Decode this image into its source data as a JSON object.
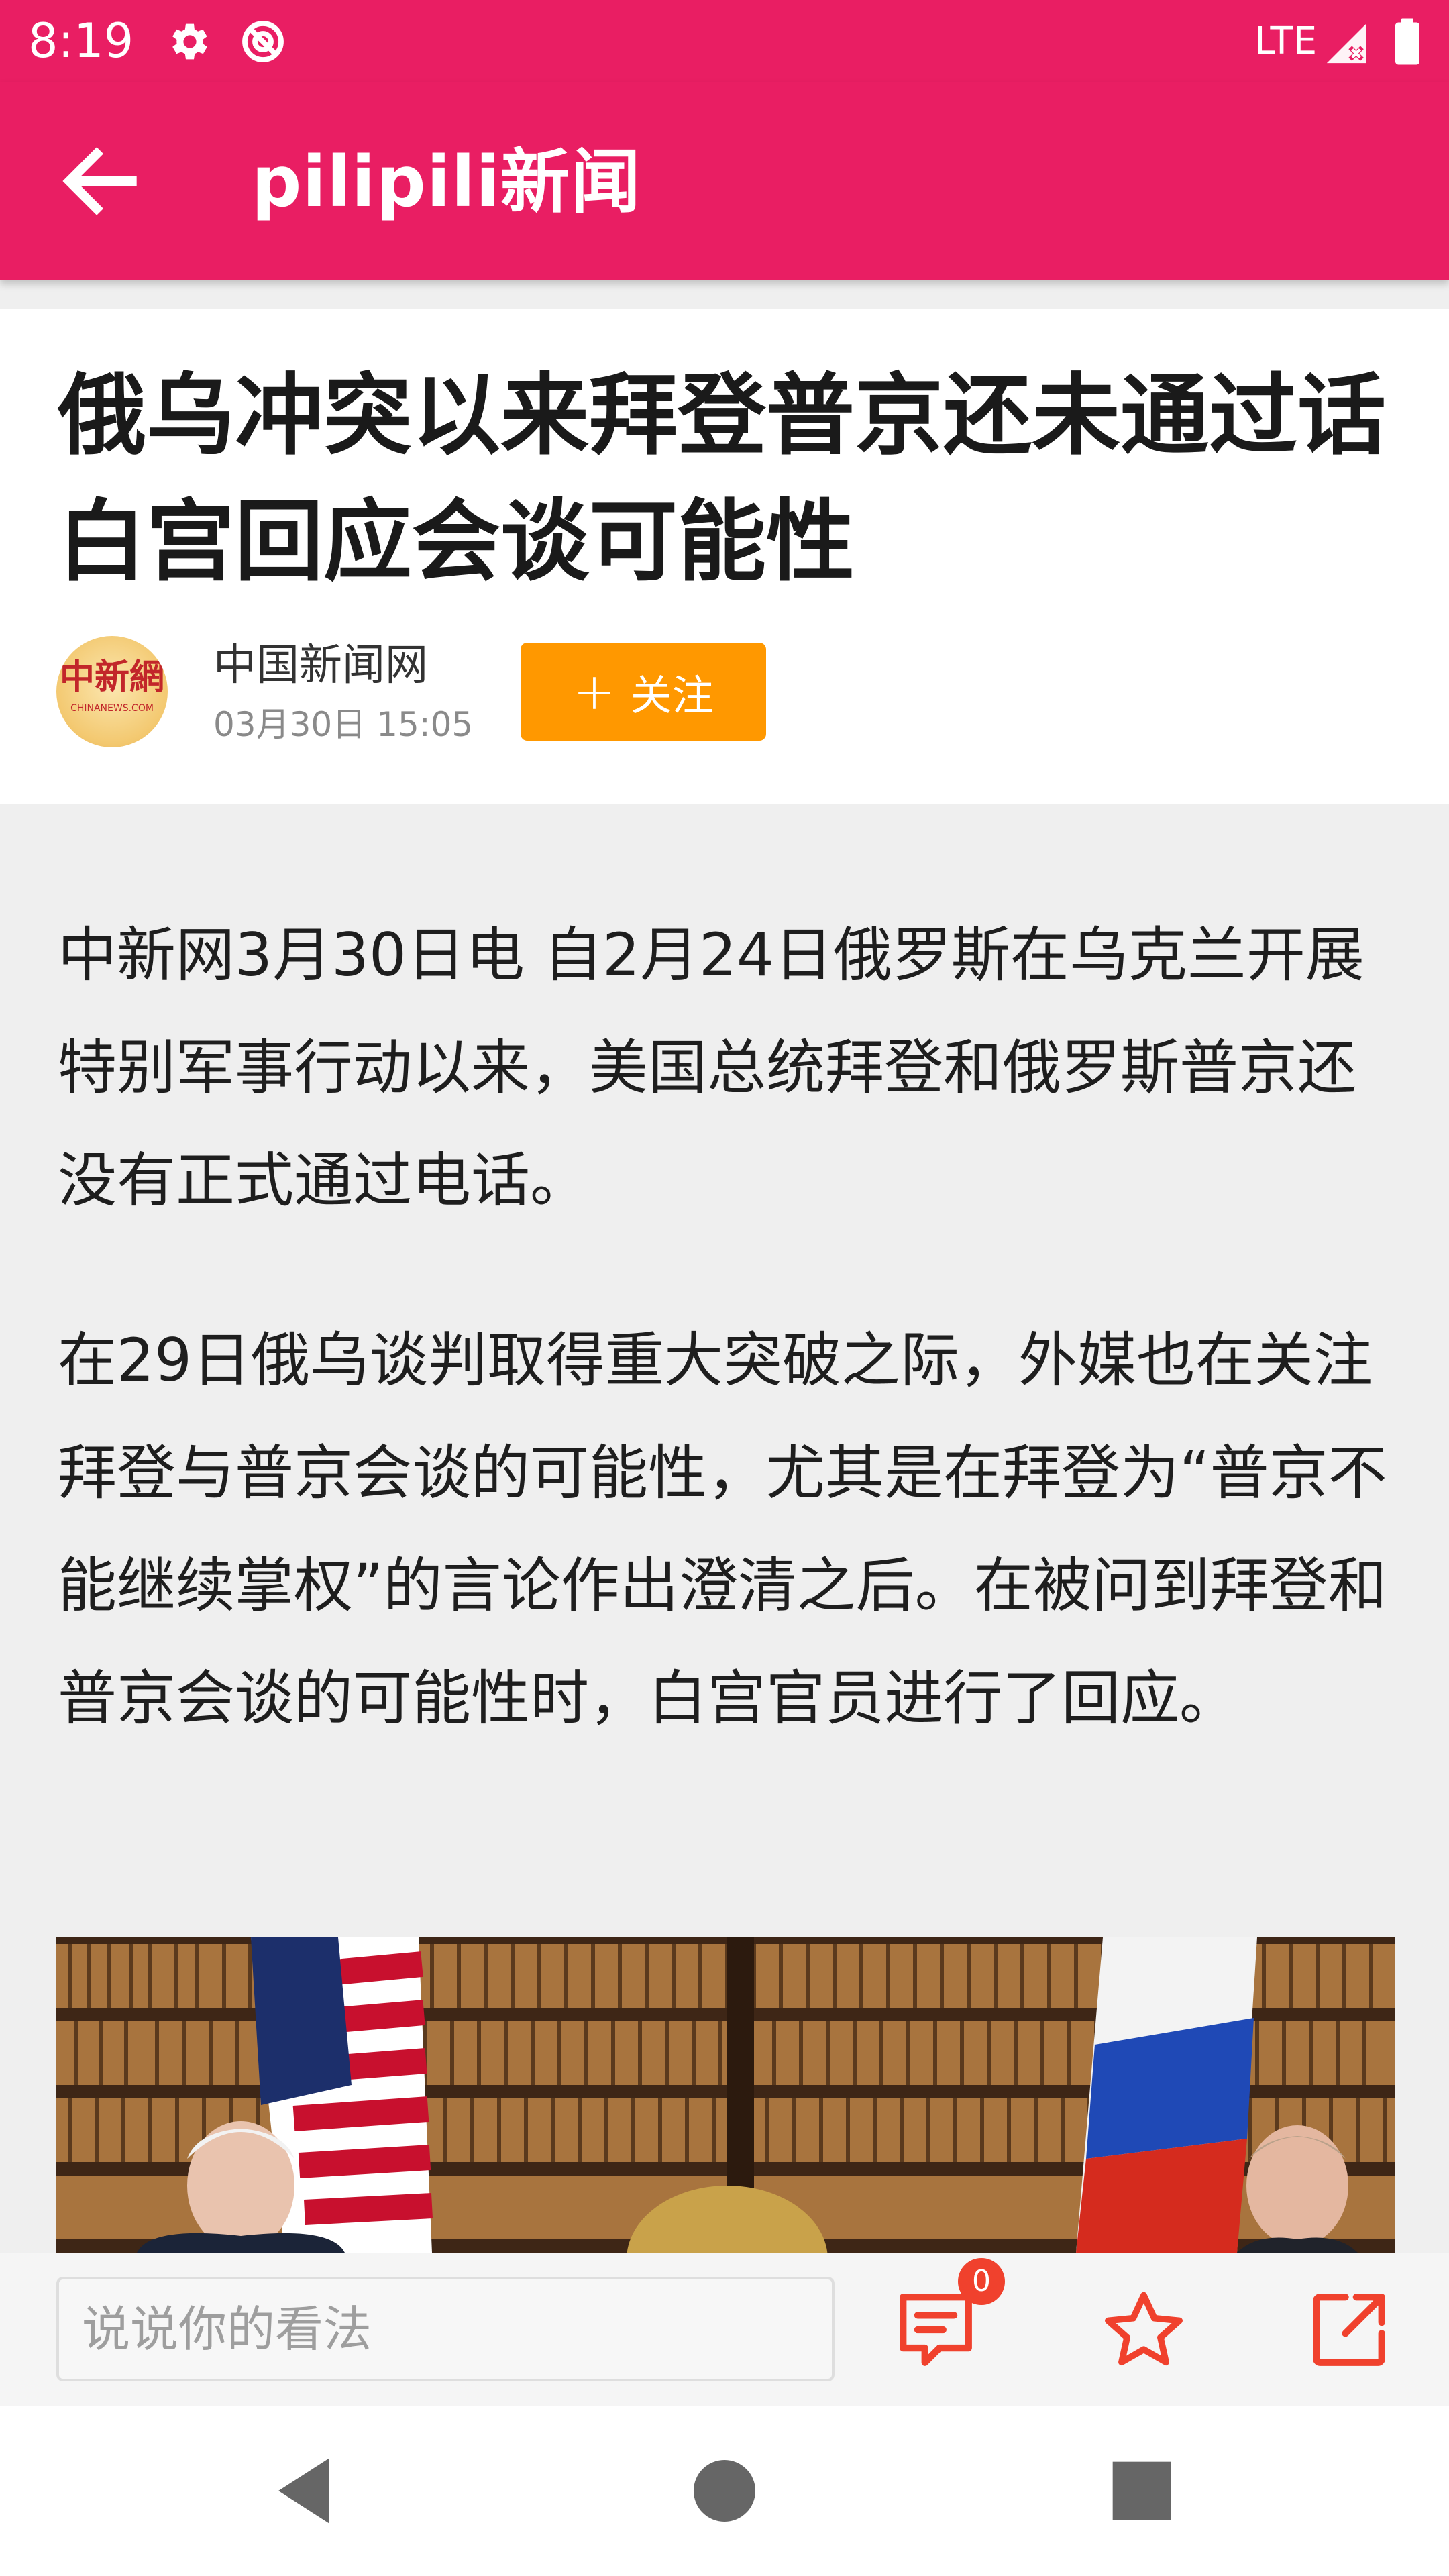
{
  "status_bar": {
    "time": "8:19",
    "network": "LTE",
    "icons": [
      "settings-icon",
      "sync-disabled-icon",
      "signal-icon",
      "battery-icon"
    ]
  },
  "app_bar": {
    "title": "pilipili新闻",
    "back_icon": "arrow-left-icon"
  },
  "article": {
    "title": "俄乌冲突以来拜登普京还未通过话 白宫回应会谈可能性",
    "source": {
      "name": "中国新闻网",
      "time": "03月30日  15:05",
      "logo_text": "中新網",
      "logo_subtext": "CHINANEWS.COM"
    },
    "follow_label": "关注",
    "paragraphs": [
      "中新网3月30日电 自2月24日俄罗斯在乌克兰开展特别军事行动以来，美国总统拜登和俄罗斯普京还没有正式通过电话。",
      "在29日俄乌谈判取得重大突破之际，外媒也在关注拜登与普京会谈的可能性，尤其是在拜登为“普京不能继续掌权”的言论作出澄清之后。在被问到拜登和普京会谈的可能性时，白宫官员进行了回应。"
    ]
  },
  "comment_bar": {
    "placeholder": "说说你的看法",
    "comment_count": "0"
  },
  "colors": {
    "primary": "#e91e63",
    "accent": "#ff9800",
    "icon_accent": "#f0412d"
  }
}
